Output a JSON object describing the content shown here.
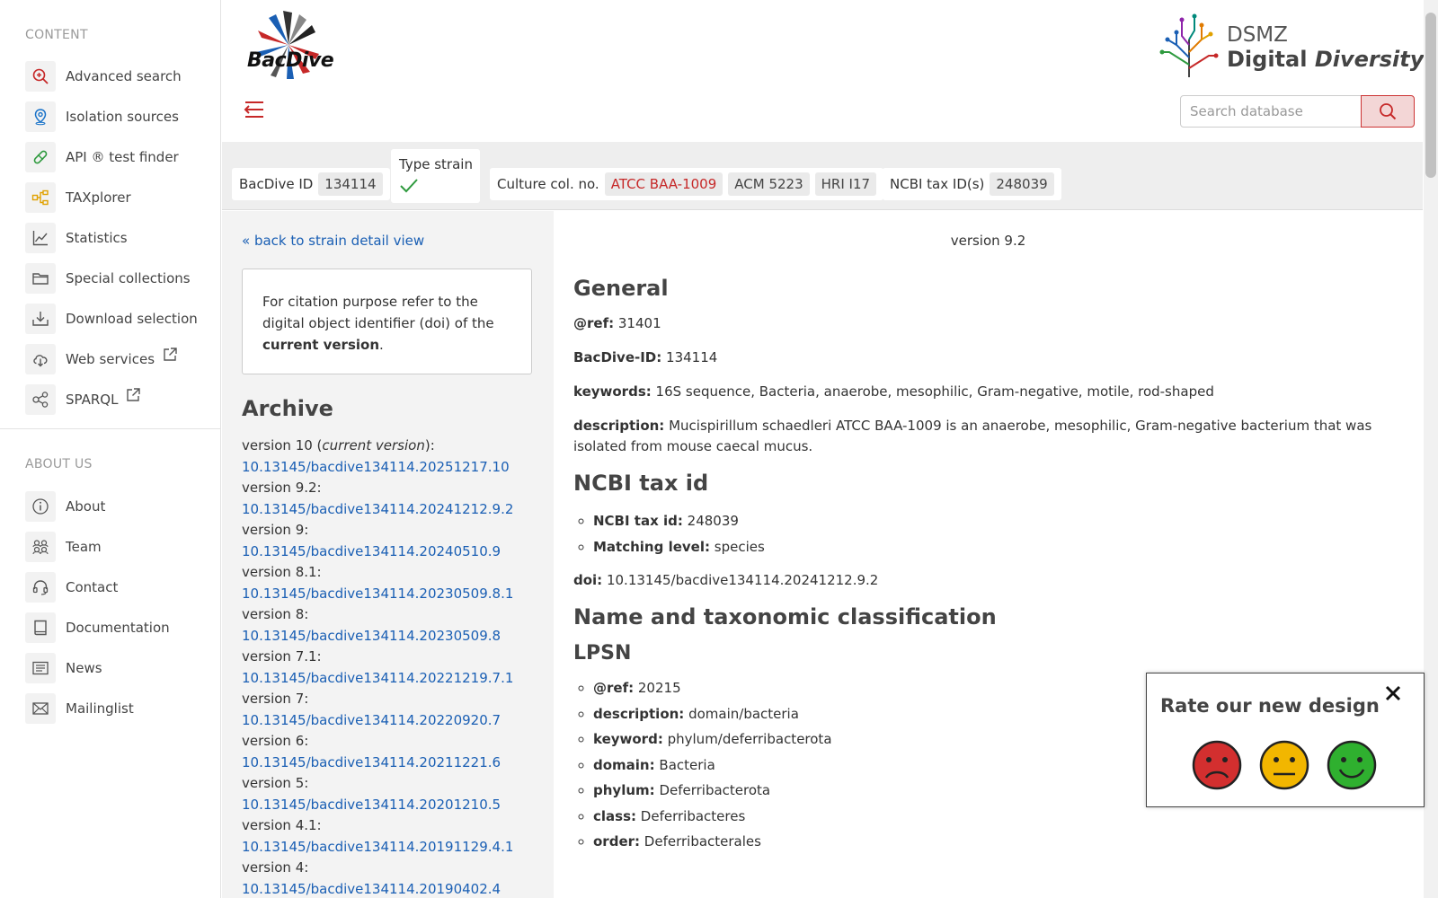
{
  "sidebar": {
    "content_heading": "CONTENT",
    "content_items": [
      {
        "label": "Advanced search",
        "icon": "search-plus-icon",
        "color": "#c62828"
      },
      {
        "label": "Isolation sources",
        "icon": "location-pin-icon",
        "color": "#1a73c9"
      },
      {
        "label": "API ® test finder",
        "icon": "pill-icon",
        "color": "#2e9a3e"
      },
      {
        "label": "TAXplorer",
        "icon": "tree-structure-icon",
        "color": "#e0a100"
      },
      {
        "label": "Statistics",
        "icon": "line-chart-icon",
        "color": "#555555"
      },
      {
        "label": "Special collections",
        "icon": "folder-icon",
        "color": "#555555"
      },
      {
        "label": "Download selection",
        "icon": "download-icon",
        "color": "#555555"
      },
      {
        "label": "Web services",
        "icon": "cloud-download-icon",
        "color": "#555555",
        "external": true
      },
      {
        "label": "SPARQL",
        "icon": "share-nodes-icon",
        "color": "#555555",
        "external": true
      }
    ],
    "about_heading": "ABOUT US",
    "about_items": [
      {
        "label": "About",
        "icon": "info-icon"
      },
      {
        "label": "Team",
        "icon": "team-icon"
      },
      {
        "label": "Contact",
        "icon": "headset-icon"
      },
      {
        "label": "Documentation",
        "icon": "book-icon"
      },
      {
        "label": "News",
        "icon": "newspaper-icon"
      },
      {
        "label": "Mailinglist",
        "icon": "envelope-icon"
      }
    ]
  },
  "header": {
    "logo_text": "BacDive",
    "org_line1": "DSMZ",
    "org_line2a": "Digital",
    "org_line2b": "Diversity",
    "search_placeholder": "Search database"
  },
  "infobar": {
    "bacdive_id_label": "BacDive ID",
    "bacdive_id": "134114",
    "type_strain_label": "Type strain",
    "culture_label": "Culture col. no.",
    "culture_numbers": [
      "ATCC BAA-1009",
      "ACM 5223",
      "HRI I17"
    ],
    "ncbi_label": "NCBI tax ID(s)",
    "ncbi_id": "248039"
  },
  "left": {
    "back_link": "« back to strain detail view",
    "cite_text_a": "For citation purpose refer to the digital object identifier (doi) of the",
    "cite_text_b": "current version",
    "cite_text_c": ".",
    "archive_heading": "Archive",
    "versions": [
      {
        "label": "version 10 (",
        "current": "current version",
        "label_end": "):",
        "doi": "10.13145/bacdive134114.20251217.10"
      },
      {
        "label": "version 9.2:",
        "doi": "10.13145/bacdive134114.20241212.9.2"
      },
      {
        "label": "version 9:",
        "doi": "10.13145/bacdive134114.20240510.9"
      },
      {
        "label": "version 8.1:",
        "doi": "10.13145/bacdive134114.20230509.8.1"
      },
      {
        "label": "version 8:",
        "doi": "10.13145/bacdive134114.20230509.8"
      },
      {
        "label": "version 7.1:",
        "doi": "10.13145/bacdive134114.20221219.7.1"
      },
      {
        "label": "version 7:",
        "doi": "10.13145/bacdive134114.20220920.7"
      },
      {
        "label": "version 6:",
        "doi": "10.13145/bacdive134114.20211221.6"
      },
      {
        "label": "version 5:",
        "doi": "10.13145/bacdive134114.20201210.5"
      },
      {
        "label": "version 4.1:",
        "doi": "10.13145/bacdive134114.20191129.4.1"
      },
      {
        "label": "version 4:",
        "doi": "10.13145/bacdive134114.20190402.4"
      }
    ]
  },
  "main": {
    "version_note": "version 9.2",
    "general_heading": "General",
    "general": [
      {
        "key": "@ref:",
        "value": "31401"
      },
      {
        "key": "BacDive-ID:",
        "value": "134114"
      },
      {
        "key": "keywords:",
        "value": "16S sequence, Bacteria, anaerobe, mesophilic, Gram-negative, motile, rod-shaped"
      },
      {
        "key": "description:",
        "value": "Mucispirillum schaedleri ATCC BAA-1009 is an anaerobe, mesophilic, Gram-negative bacterium that was isolated from mouse caecal mucus."
      }
    ],
    "ncbi_heading": "NCBI tax id",
    "ncbi": [
      {
        "key": "NCBI tax id:",
        "value": "248039"
      },
      {
        "key": "Matching level:",
        "value": "species"
      }
    ],
    "doi_key": "doi:",
    "doi_value": "10.13145/bacdive134114.20241212.9.2",
    "taxo_heading": "Name and taxonomic classification",
    "lpsn_heading": "LPSN",
    "lpsn": [
      {
        "key": "@ref:",
        "value": "20215"
      },
      {
        "key": "description:",
        "value": "domain/bacteria"
      },
      {
        "key": "keyword:",
        "value": "phylum/deferribacterota"
      },
      {
        "key": "domain:",
        "value": "Bacteria"
      },
      {
        "key": "phylum:",
        "value": "Deferribacterota"
      },
      {
        "key": "class:",
        "value": "Deferribacteres"
      },
      {
        "key": "order:",
        "value": "Deferribacterales"
      }
    ]
  },
  "rating": {
    "title": "Rate our new design",
    "faces": [
      {
        "icon": "sad-face-icon",
        "color": "#d32f2f"
      },
      {
        "icon": "neutral-face-icon",
        "color": "#f2b600"
      },
      {
        "icon": "happy-face-icon",
        "color": "#2fb02f"
      }
    ]
  },
  "colors": {
    "accent_red": "#c62828",
    "link_blue": "#1a5fb4"
  }
}
